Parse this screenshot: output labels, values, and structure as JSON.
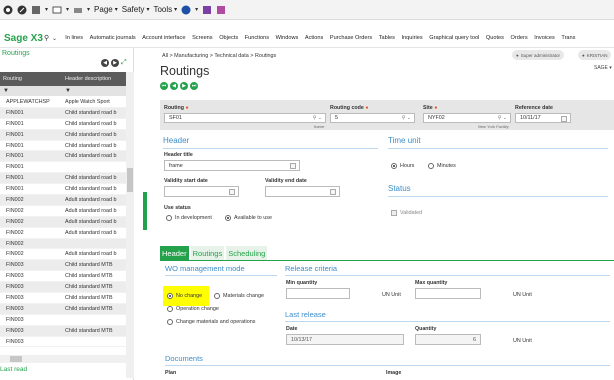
{
  "ie": {
    "menus": [
      "Page",
      "Safety",
      "Tools"
    ]
  },
  "sage": {
    "logo": "Sage X3",
    "nav": [
      "In lines",
      "Automatic journals",
      "Account interface",
      "Screens",
      "Objects",
      "Functions",
      "Windows",
      "Actions",
      "Purchase Orders",
      "Tables",
      "Inquiries",
      "Graphical query tool",
      "Quotes",
      "Orders",
      "Invoices",
      "Trans"
    ],
    "user": "Super administrator",
    "user2": "KRISTIAN",
    "company": "SAGE"
  },
  "left": {
    "title": "Routings",
    "col1": "Routing",
    "col2": "Header description",
    "rows": [
      {
        "code": "APPLEWATCHSP",
        "desc": "Apple Watch Sport"
      },
      {
        "code": "FIN001",
        "desc": "Child standard road b"
      },
      {
        "code": "FIN001",
        "desc": "Child standard road b"
      },
      {
        "code": "FIN001",
        "desc": "Child standard road b"
      },
      {
        "code": "FIN001",
        "desc": "Child standard road b"
      },
      {
        "code": "FIN001",
        "desc": "Child standard road b"
      },
      {
        "code": "FIN001",
        "desc": ""
      },
      {
        "code": "FIN001",
        "desc": "Child standard road b"
      },
      {
        "code": "FIN001",
        "desc": "Child standard road b"
      },
      {
        "code": "FIN002",
        "desc": "Adult standard road b"
      },
      {
        "code": "FIN002",
        "desc": "Adult standard road b"
      },
      {
        "code": "FIN002",
        "desc": "Adult standard road b"
      },
      {
        "code": "FIN002",
        "desc": "Adult standard road b"
      },
      {
        "code": "FIN002",
        "desc": ""
      },
      {
        "code": "FIN002",
        "desc": "Adult standard road b"
      },
      {
        "code": "FIN003",
        "desc": "Child standard MTB"
      },
      {
        "code": "FIN003",
        "desc": "Child standard MTB"
      },
      {
        "code": "FIN003",
        "desc": "Child standard MTB"
      },
      {
        "code": "FIN003",
        "desc": "Child standard MTB"
      },
      {
        "code": "FIN003",
        "desc": "Child standard MTB"
      },
      {
        "code": "FIN003",
        "desc": ""
      },
      {
        "code": "FIN003",
        "desc": "Child standard MTB"
      },
      {
        "code": "FIN003",
        "desc": ""
      }
    ],
    "last_read": "Last read"
  },
  "main": {
    "breadcrumb": "All  >  Manufacturing  >  Technical data  >  Routings",
    "title": "Routings",
    "key": {
      "routing_label": "Routing",
      "routing_value": "SF01",
      "routing_sub": "frame",
      "code_label": "Routing code",
      "code_value": "5",
      "site_label": "Site",
      "site_value": "NYF02",
      "site_sub": "New York Facility",
      "ref_label": "Reference date",
      "ref_value": "10/11/17"
    },
    "header": {
      "title": "Header",
      "ht_label": "Header title",
      "ht_value": "frame",
      "vstart_label": "Validity start date",
      "vend_label": "Validity end date",
      "use_label": "Use status",
      "use_opt1": "In development",
      "use_opt2": "Available to use"
    },
    "timeunit": {
      "title": "Time unit",
      "opt1": "Hours",
      "opt2": "Minutes"
    },
    "status": {
      "title": "Status",
      "validated": "Validated"
    },
    "tabs": [
      "Header",
      "Routings",
      "Scheduling"
    ],
    "wo": {
      "title": "WO management mode",
      "opt1": "No change",
      "opt2": "Materials change",
      "opt3": "Operation change",
      "opt4": "Change materials and operations"
    },
    "release": {
      "title": "Release criteria",
      "min_label": "Min quantity",
      "max_label": "Max quantity",
      "unit1": "UN Unit",
      "unit2": "UN Unit"
    },
    "last": {
      "title": "Last release",
      "date_label": "Date",
      "date_value": "10/13/17",
      "qty_label": "Quantity",
      "qty_value": "6",
      "unit": "UN Unit"
    },
    "documents": {
      "title": "Documents",
      "col1": "Plan",
      "col2": "Image"
    }
  }
}
